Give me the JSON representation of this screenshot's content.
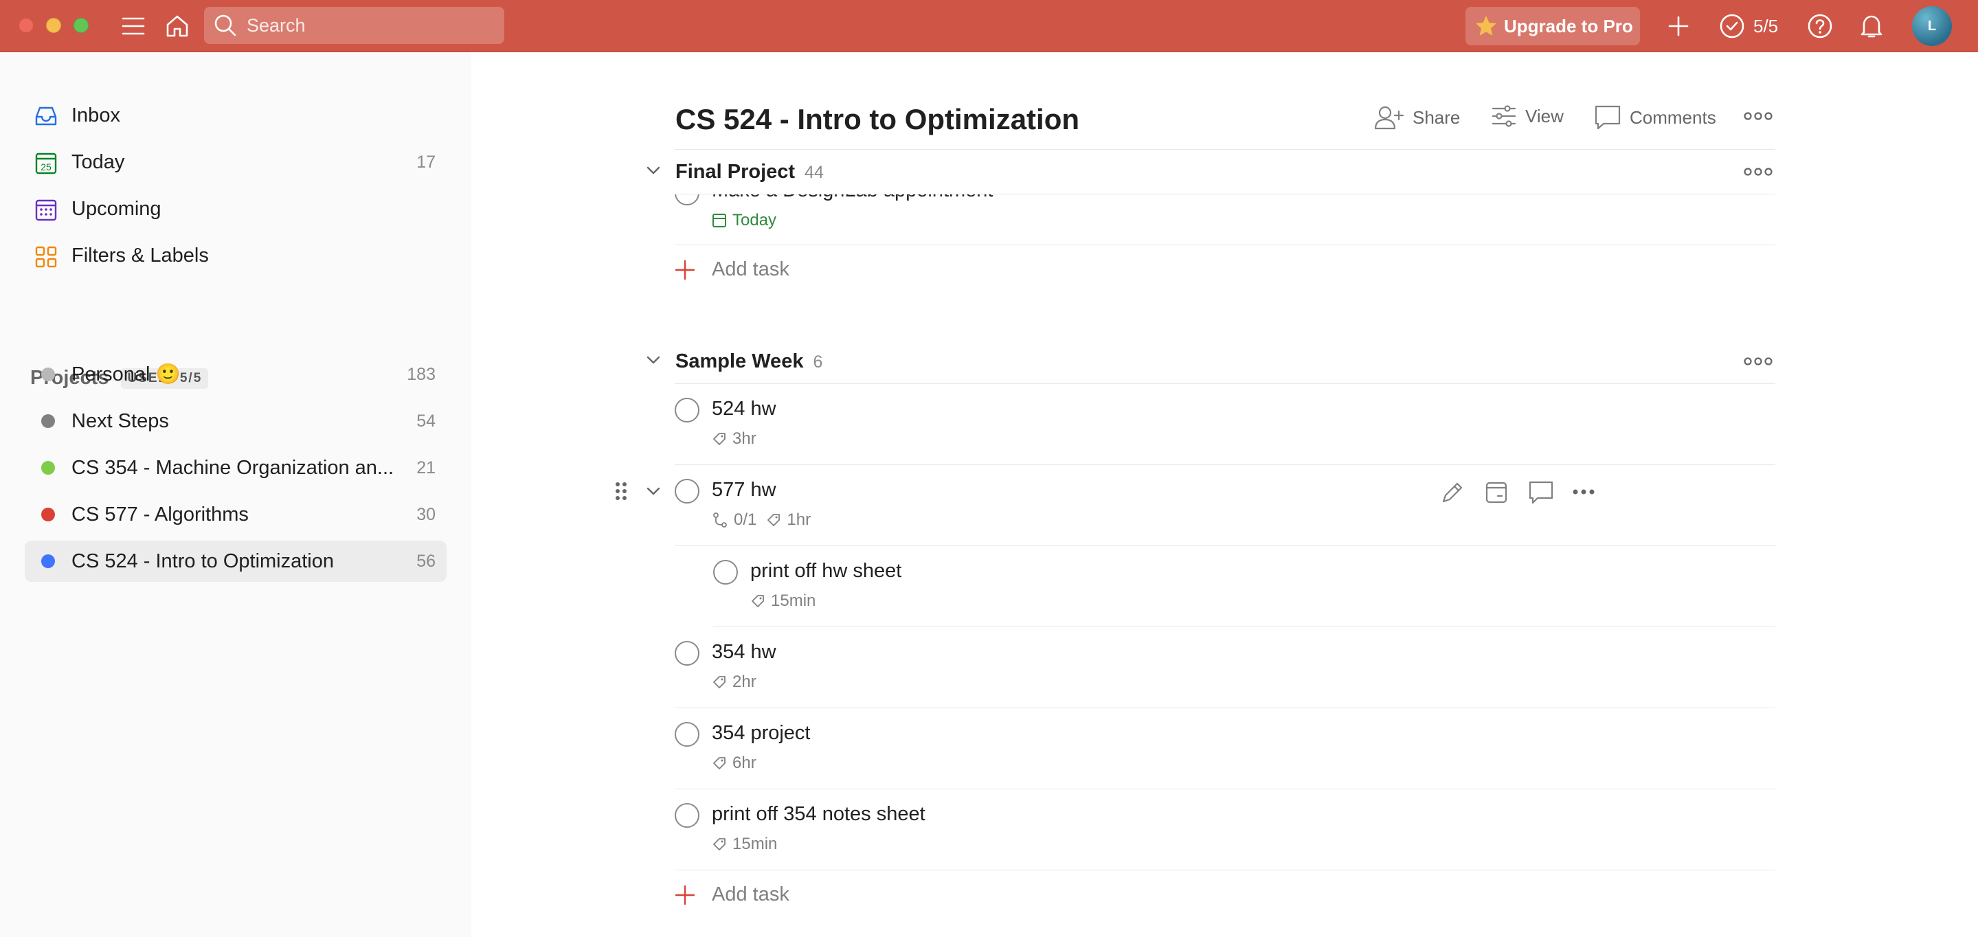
{
  "topbar": {
    "search_placeholder": "Search",
    "upgrade_label": "Upgrade to Pro",
    "karma_label": "5/5",
    "avatar_initial": "L",
    "accent_color": "#cf5646"
  },
  "sidebar": {
    "nav": [
      {
        "label": "Inbox",
        "icon": "inbox-icon",
        "count": ""
      },
      {
        "label": "Today",
        "icon": "calendar-today-icon",
        "count": "17"
      },
      {
        "label": "Upcoming",
        "icon": "calendar-upcoming-icon",
        "count": ""
      },
      {
        "label": "Filters & Labels",
        "icon": "filters-icon",
        "count": ""
      }
    ],
    "projects_title": "Projects",
    "projects_badge": "USED: 5/5",
    "projects": [
      {
        "label": "Personal 🙂",
        "count": "183",
        "color": "#b8b8b8"
      },
      {
        "label": "Next Steps",
        "count": "54",
        "color": "#808080"
      },
      {
        "label": "CS 354 - Machine Organization an...",
        "count": "21",
        "color": "#7ecc49"
      },
      {
        "label": "CS 577 - Algorithms",
        "count": "30",
        "color": "#db4035"
      },
      {
        "label": "CS 524 - Intro to Optimization",
        "count": "56",
        "color": "#4073ff"
      }
    ]
  },
  "main": {
    "title": "CS 524 - Intro to Optimization",
    "actions": {
      "share": "Share",
      "view": "View",
      "comments": "Comments"
    },
    "sections": [
      {
        "name": "Final Project",
        "count": "44",
        "partial_task": {
          "name": "Make a DesignLab appointment",
          "due": "Today"
        },
        "add_task": "Add task"
      },
      {
        "name": "Sample Week",
        "count": "6",
        "tasks": [
          {
            "name": "524 hw",
            "label": "3hr"
          },
          {
            "name": "577 hw",
            "subtasks": "0/1",
            "label": "1hr"
          },
          {
            "name": "print off hw sheet",
            "label": "15min"
          },
          {
            "name": "354 hw",
            "label": "2hr"
          },
          {
            "name": "354 project",
            "label": "6hr"
          },
          {
            "name": "print off 354 notes sheet",
            "label": "15min"
          }
        ],
        "add_task": "Add task"
      }
    ]
  }
}
